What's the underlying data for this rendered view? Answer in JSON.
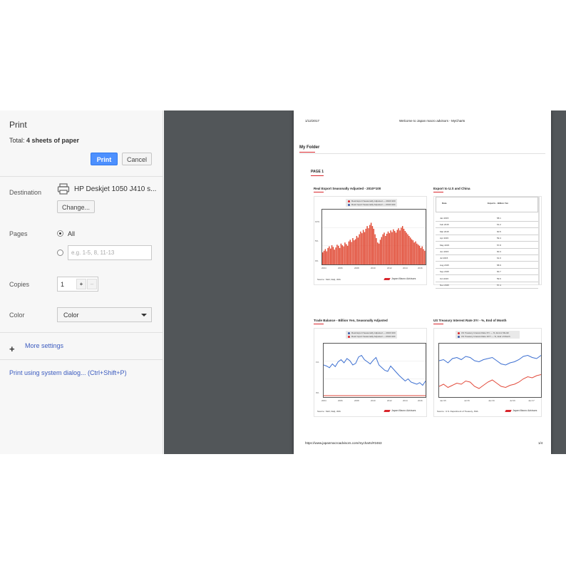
{
  "dialog": {
    "title": "Print",
    "total_label": "Total: ",
    "total_value": "4 sheets of paper",
    "print_button": "Print",
    "cancel_button": "Cancel",
    "destination_label": "Destination",
    "destination_name": "HP Deskjet 1050 J410 s...",
    "change_button": "Change...",
    "pages_label": "Pages",
    "pages_all": "All",
    "pages_placeholder": "e.g. 1-5, 8, 11-13",
    "copies_label": "Copies",
    "copies_value": "1",
    "copies_plus": "+",
    "copies_minus": "–",
    "color_label": "Color",
    "color_value": "Color",
    "more_settings": "More settings",
    "system_dialog": "Print using system dialog... (Ctrl+Shift+P)"
  },
  "preview": {
    "date": "1/12/2017",
    "page_title": "Welcome to Japan macro advisors - MyCharts",
    "folder": "My Folder",
    "page_label": "PAGE 1",
    "url": "https://www.japanmacroadvisors.com/mycharts/#2463",
    "page_number": "1/4",
    "logo_text": "Japan Macro Advisors",
    "charts": [
      {
        "title": "Real Export Seasonally Adjusted - 2010=100",
        "legend": [
          "Real Export Seasonally Adjusted — 2010=100",
          "Real Import Seasonally Adjusted — 2010=100"
        ],
        "yticks": [
          "0%",
          "5%",
          "10%"
        ],
        "xticks": [
          "2004",
          "2006",
          "2008",
          "2010",
          "2012",
          "2014",
          "2016"
        ],
        "source": "Source : MoF, Daiji, JMA"
      },
      {
        "title": "Export to U.S and China",
        "header": [
          "Date",
          "Exports - Billion Yen"
        ],
        "rows": [
          [
            "Jan 2015",
            "58.1"
          ],
          [
            "Feb 2015",
            "61.2"
          ],
          [
            "Mar 2015",
            "60.5"
          ],
          [
            "Apr 2015",
            "59.4"
          ],
          [
            "May 2015",
            "57.8"
          ],
          [
            "Jun 2015",
            "60.3"
          ],
          [
            "Jul 2015",
            "61.0"
          ],
          [
            "Aug 2015",
            "58.9"
          ],
          [
            "Sep 2015",
            "60.7"
          ],
          [
            "Oct 2015",
            "59.6"
          ],
          [
            "Nov 2015",
            "57.4"
          ]
        ]
      },
      {
        "title": "Trade Balance - Billion Yen, Seasonally Adjusted",
        "legend": [
          "Real Export Seasonally Adjusted — 2010=100",
          "Real Import Seasonally Adjusted — 2010=100"
        ],
        "yticks": [
          "1%",
          "0%"
        ],
        "xticks": [
          "2004",
          "2006",
          "2008",
          "2010",
          "2012",
          "2014",
          "2016"
        ],
        "source": "Source : MoF, Daiji, JMA"
      },
      {
        "title": "US Treasury Interest Rate 3Yr - %, End of Month",
        "legend": [
          "US Treasury Interest Rate 3Yr — %, End of Month",
          "US Treasury Interest Rate 10Yr — %, End of Month"
        ],
        "xticks": [
          "Jan'15",
          "Jul'15",
          "Jan'16",
          "Jul'16",
          "Jan'17"
        ],
        "source": "Source : U.S. Department of Treasury, JMA"
      }
    ]
  },
  "chart_data": [
    {
      "type": "bar",
      "title": "Real Export Seasonally Adjusted - 2010=100",
      "note": "approximate monthly values, 2004-2016",
      "values": [
        22,
        25,
        28,
        24,
        30,
        33,
        29,
        35,
        32,
        27,
        31,
        36,
        34,
        30,
        38,
        35,
        33,
        40,
        37,
        34,
        42,
        45,
        41,
        48,
        44,
        46,
        52,
        49,
        55,
        60,
        57,
        63,
        59,
        65,
        70,
        66,
        72,
        76,
        70,
        65,
        55,
        48,
        40,
        38,
        45,
        50,
        55,
        58,
        52,
        56,
        60,
        57,
        62,
        59,
        64,
        61,
        58,
        63,
        66,
        62,
        67,
        70,
        65,
        61,
        58,
        55,
        52,
        49,
        46,
        44,
        40,
        42,
        38,
        36,
        34,
        30,
        33,
        28,
        25
      ]
    },
    {
      "type": "line",
      "title": "Trade Balance - Billion Yen, Seasonally Adjusted",
      "note": "approximate normalized values",
      "values": [
        60,
        58,
        55,
        62,
        57,
        66,
        70,
        64,
        72,
        68,
        60,
        63,
        75,
        78,
        70,
        66,
        62,
        69,
        74,
        60,
        55,
        50,
        48,
        58,
        52,
        46,
        40,
        35,
        30,
        34,
        28,
        26,
        24,
        27,
        22,
        30
      ]
    },
    {
      "type": "line",
      "title": "US Treasury Interest Rate 3Yr - %, End of Month",
      "series": [
        {
          "name": "US Treasury Interest Rate 3Yr — %, End of Month",
          "values": [
            1.0,
            1.1,
            0.95,
            1.05,
            1.15,
            1.1,
            1.25,
            1.2,
            1.0,
            0.9,
            1.05,
            1.2,
            1.3,
            1.15,
            1.0,
            0.95,
            1.05,
            1.1,
            1.2,
            1.35,
            1.45,
            1.4,
            1.5,
            1.55
          ]
        },
        {
          "name": "US Treasury Interest Rate 10Yr — %, End of Month",
          "values": [
            2.2,
            2.25,
            2.1,
            2.3,
            2.35,
            2.25,
            2.4,
            2.35,
            2.2,
            2.15,
            2.25,
            2.3,
            2.35,
            2.2,
            2.05,
            2.0,
            2.1,
            2.15,
            2.25,
            2.4,
            2.45,
            2.35,
            2.3,
            2.45
          ]
        }
      ]
    }
  ]
}
